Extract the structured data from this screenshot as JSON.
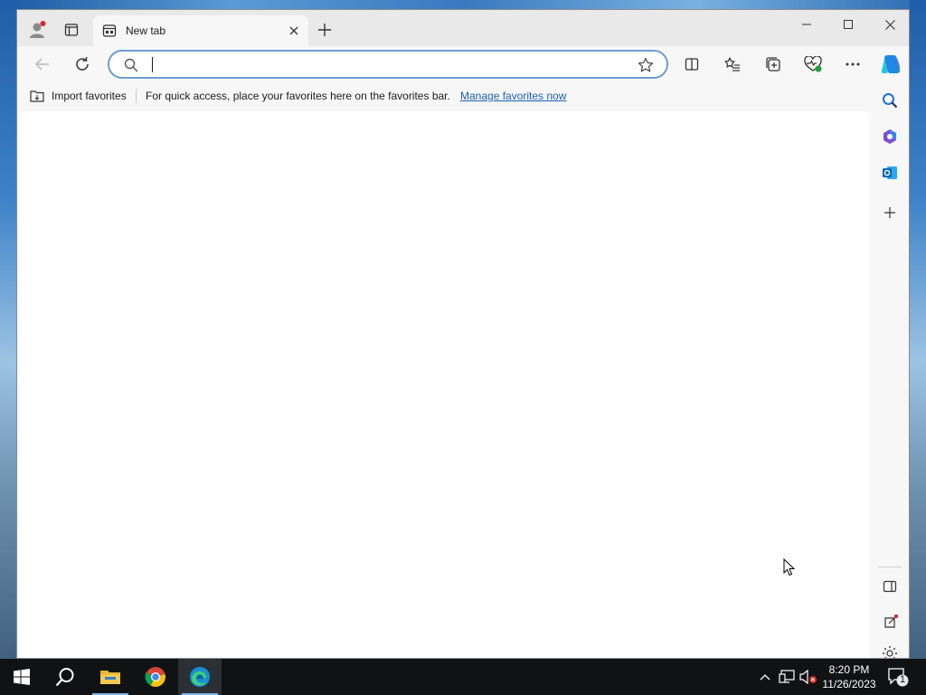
{
  "window": {
    "tab_title": "New tab",
    "minimize_icon": "minimize-icon",
    "maximize_icon": "maximize-icon",
    "close_icon": "close-icon"
  },
  "toolbar": {
    "address_value": "",
    "address_placeholder": ""
  },
  "favorites_bar": {
    "import_label": "Import favorites",
    "message": "For quick access, place your favorites here on the favorites bar.",
    "manage_link": "Manage favorites now"
  },
  "taskbar": {
    "time": "8:20 PM",
    "date": "11/26/2023",
    "notification_count": "1",
    "apps": [
      "start",
      "search",
      "file-explorer",
      "chrome",
      "edge"
    ]
  },
  "colors": {
    "accent": "#1a5fb4",
    "address_border": "#6f9dcd",
    "taskbar": "#101214"
  }
}
